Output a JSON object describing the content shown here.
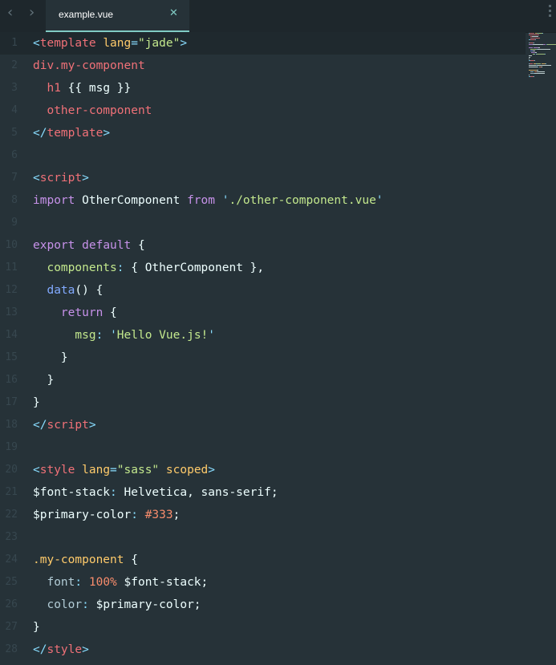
{
  "tabs": [
    {
      "label": "example.vue",
      "active": true
    }
  ],
  "theme": {
    "background": "#263238",
    "accent": "#80cbc4",
    "tag": "#f07178",
    "keyword": "#c792ea",
    "string": "#c3e88d",
    "attribute": "#ffcb6b",
    "function": "#82aaff",
    "number": "#f78c6c"
  },
  "editor": {
    "active_line": 1,
    "lines": [
      {
        "n": "1",
        "tokens": [
          [
            "<",
            "punct"
          ],
          [
            "template",
            "tag"
          ],
          [
            " ",
            ""
          ],
          [
            "lang",
            "attr"
          ],
          [
            "=",
            "punct"
          ],
          [
            "\"jade\"",
            "str"
          ],
          [
            ">",
            "punct"
          ]
        ]
      },
      {
        "n": "2",
        "tokens": [
          [
            "div.my-component",
            "tag"
          ]
        ]
      },
      {
        "n": "3",
        "tokens": [
          [
            "  ",
            ""
          ],
          [
            "h1",
            "tag"
          ],
          [
            " {{ msg }}",
            "var"
          ]
        ]
      },
      {
        "n": "4",
        "tokens": [
          [
            "  ",
            ""
          ],
          [
            "other-component",
            "tag"
          ]
        ]
      },
      {
        "n": "5",
        "tokens": [
          [
            "</",
            "punct"
          ],
          [
            "template",
            "tag"
          ],
          [
            ">",
            "punct"
          ]
        ]
      },
      {
        "n": "6",
        "tokens": []
      },
      {
        "n": "7",
        "tokens": [
          [
            "<",
            "punct"
          ],
          [
            "script",
            "tag"
          ],
          [
            ">",
            "punct"
          ]
        ]
      },
      {
        "n": "8",
        "tokens": [
          [
            "import",
            "kw"
          ],
          [
            " OtherComponent ",
            "var"
          ],
          [
            "from",
            "kw"
          ],
          [
            " ",
            ""
          ],
          [
            "'",
            "punct"
          ],
          [
            "./other-component.vue",
            "str"
          ],
          [
            "'",
            "punct"
          ]
        ]
      },
      {
        "n": "9",
        "tokens": []
      },
      {
        "n": "10",
        "tokens": [
          [
            "export",
            "kw"
          ],
          [
            " ",
            ""
          ],
          [
            "default",
            "kw"
          ],
          [
            " {",
            "var"
          ]
        ]
      },
      {
        "n": "11",
        "tokens": [
          [
            "  ",
            ""
          ],
          [
            "components",
            "prop2"
          ],
          [
            ":",
            "punct"
          ],
          [
            " { OtherComponent },",
            "var"
          ]
        ]
      },
      {
        "n": "12",
        "tokens": [
          [
            "  ",
            ""
          ],
          [
            "data",
            "fn"
          ],
          [
            "() {",
            "var"
          ]
        ]
      },
      {
        "n": "13",
        "tokens": [
          [
            "    ",
            ""
          ],
          [
            "return",
            "kw"
          ],
          [
            " {",
            "var"
          ]
        ]
      },
      {
        "n": "14",
        "tokens": [
          [
            "      ",
            ""
          ],
          [
            "msg",
            "prop2"
          ],
          [
            ":",
            "punct"
          ],
          [
            " ",
            ""
          ],
          [
            "'",
            "punct"
          ],
          [
            "Hello Vue.js!",
            "str"
          ],
          [
            "'",
            "punct"
          ]
        ]
      },
      {
        "n": "15",
        "tokens": [
          [
            "    }",
            "var"
          ]
        ]
      },
      {
        "n": "16",
        "tokens": [
          [
            "  }",
            "var"
          ]
        ]
      },
      {
        "n": "17",
        "tokens": [
          [
            "}",
            "var"
          ]
        ]
      },
      {
        "n": "18",
        "tokens": [
          [
            "</",
            "punct"
          ],
          [
            "script",
            "tag"
          ],
          [
            ">",
            "punct"
          ]
        ]
      },
      {
        "n": "19",
        "tokens": []
      },
      {
        "n": "20",
        "tokens": [
          [
            "<",
            "punct"
          ],
          [
            "style",
            "tag"
          ],
          [
            " ",
            ""
          ],
          [
            "lang",
            "attr"
          ],
          [
            "=",
            "punct"
          ],
          [
            "\"sass\"",
            "str"
          ],
          [
            " ",
            ""
          ],
          [
            "scoped",
            "attr"
          ],
          [
            ">",
            "punct"
          ]
        ]
      },
      {
        "n": "21",
        "tokens": [
          [
            "$font-stack",
            "var"
          ],
          [
            ":",
            "punct"
          ],
          [
            " Helvetica, sans-serif;",
            "var"
          ]
        ]
      },
      {
        "n": "22",
        "tokens": [
          [
            "$primary-color",
            "var"
          ],
          [
            ":",
            "punct"
          ],
          [
            " ",
            ""
          ],
          [
            "#333",
            "num"
          ],
          [
            ";",
            "var"
          ]
        ]
      },
      {
        "n": "23",
        "tokens": []
      },
      {
        "n": "24",
        "tokens": [
          [
            ".my-component",
            "attr"
          ],
          [
            " {",
            "var"
          ]
        ]
      },
      {
        "n": "25",
        "tokens": [
          [
            "  ",
            ""
          ],
          [
            "font",
            "prop"
          ],
          [
            ":",
            "punct"
          ],
          [
            " ",
            ""
          ],
          [
            "100%",
            "num"
          ],
          [
            " $font-stack;",
            "var"
          ]
        ]
      },
      {
        "n": "26",
        "tokens": [
          [
            "  ",
            ""
          ],
          [
            "color",
            "prop"
          ],
          [
            ":",
            "punct"
          ],
          [
            " $primary-color;",
            "var"
          ]
        ]
      },
      {
        "n": "27",
        "tokens": [
          [
            "}",
            "var"
          ]
        ]
      },
      {
        "n": "28",
        "tokens": [
          [
            "</",
            "punct"
          ],
          [
            "style",
            "tag"
          ],
          [
            ">",
            "punct"
          ]
        ]
      }
    ]
  }
}
